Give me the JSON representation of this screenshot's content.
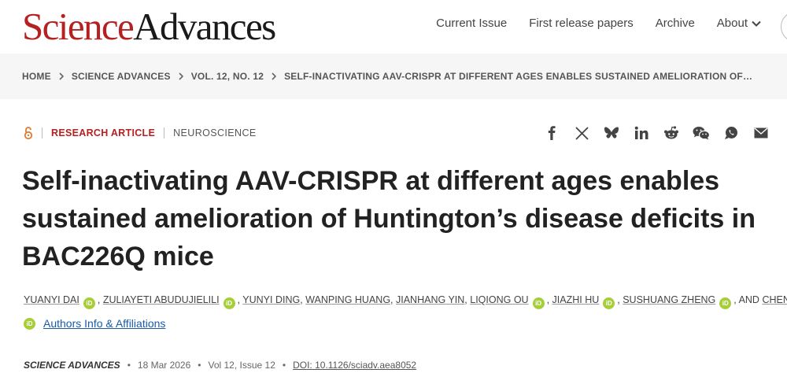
{
  "logo": {
    "part1": "Science",
    "part2": "Advances"
  },
  "nav": {
    "current_issue": "Current Issue",
    "first_release": "First release papers",
    "archive": "Archive",
    "about": "About"
  },
  "breadcrumb": [
    "HOME",
    "SCIENCE ADVANCES",
    "VOL. 12, NO. 12",
    "SELF-INACTIVATING AAV-CRISPR AT DIFFERENT AGES ENABLES SUSTAINED AMELIORATION OF…"
  ],
  "article": {
    "type": "RESEARCH ARTICLE",
    "subject": "NEUROSCIENCE",
    "title": "Self-inactivating AAV-CRISPR at different ages enables sustained amelioration of Huntington’s disease deficits in BAC226Q mice",
    "authors": [
      "YUANYI DAI",
      "ZULIAYETI ABUDUJIELILI",
      "YUNYI DING",
      "WANPING HUANG",
      "JIANHANG YIN",
      "LIQIONG OU",
      "JIAZHI HU",
      "SUSHUANG ZHENG",
      "CHENJIAN LI"
    ],
    "and_text": "AND",
    "affiliations_link": "Authors Info & Affiliations",
    "journal": "SCIENCE ADVANCES",
    "date": "18 Mar 2026",
    "volume": "Vol 12, Issue 12",
    "doi": "DOI: 10.1126/sciadv.aea8052"
  },
  "orcid_label": "iD",
  "share_icons": [
    "facebook-icon",
    "x-icon",
    "bluesky-icon",
    "linkedin-icon",
    "reddit-icon",
    "wechat-icon",
    "whatsapp-icon",
    "email-icon"
  ]
}
